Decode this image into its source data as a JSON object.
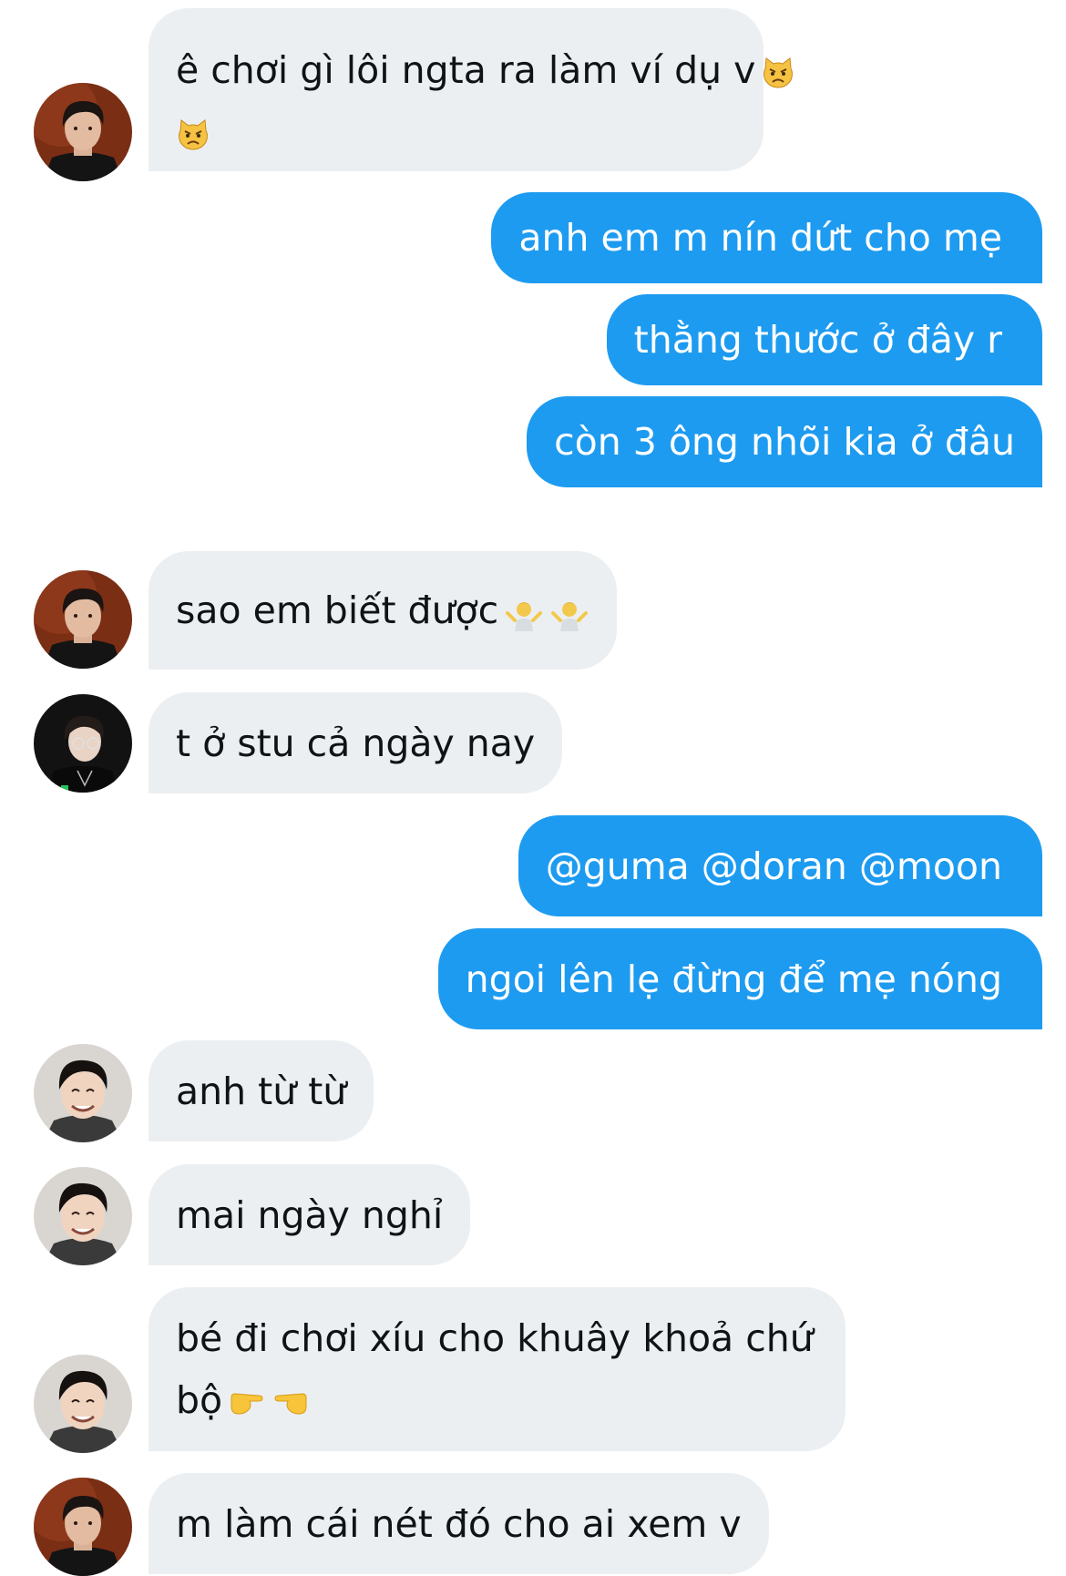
{
  "conversation": {
    "messages": [
      {
        "direction": "incoming",
        "sender_avatar": "avatar-red-suit",
        "lines": [
          "ê chơi gì lôi ngta ra làm ví dụ v"
        ],
        "emojis": [
          "pouting-cat-emoji",
          "pouting-cat-emoji"
        ]
      },
      {
        "direction": "outgoing",
        "lines": [
          "anh em m nín dứt cho mẹ"
        ]
      },
      {
        "direction": "outgoing",
        "lines": [
          "thằng thước ở đây r"
        ]
      },
      {
        "direction": "outgoing",
        "lines": [
          "còn 3 ông nhõi kia ở đâu"
        ]
      },
      {
        "direction": "incoming",
        "sender_avatar": "avatar-red-suit",
        "lines": [
          "sao em biết được"
        ],
        "emojis": [
          "person-shrugging-emoji",
          "person-shrugging-emoji"
        ]
      },
      {
        "direction": "incoming",
        "sender_avatar": "avatar-glasses",
        "lines": [
          "t ở stu cả ngày nay"
        ]
      },
      {
        "direction": "outgoing",
        "lines": [
          "@guma @doran @moon"
        ]
      },
      {
        "direction": "outgoing",
        "lines": [
          "ngoi lên lẹ đừng để mẹ nóng"
        ]
      },
      {
        "direction": "incoming",
        "sender_avatar": "avatar-smiling",
        "lines": [
          "anh từ từ"
        ]
      },
      {
        "direction": "incoming",
        "sender_avatar": "avatar-smiling",
        "lines": [
          "mai ngày nghỉ"
        ]
      },
      {
        "direction": "incoming",
        "sender_avatar": "avatar-smiling",
        "lines": [
          "bé đi chơi xíu cho khuây khoả chứ",
          "bộ"
        ],
        "emojis": [
          "backhand-pointing-right-emoji",
          "backhand-pointing-left-emoji"
        ]
      },
      {
        "direction": "incoming",
        "sender_avatar": "avatar-red-suit",
        "lines": [
          "m làm cái nét đó cho ai xem v"
        ]
      }
    ]
  },
  "colors": {
    "outgoing_bubble": "#1d9bf0",
    "incoming_bubble": "#eceff2",
    "incoming_text": "#101316",
    "outgoing_text": "#ffffff"
  }
}
